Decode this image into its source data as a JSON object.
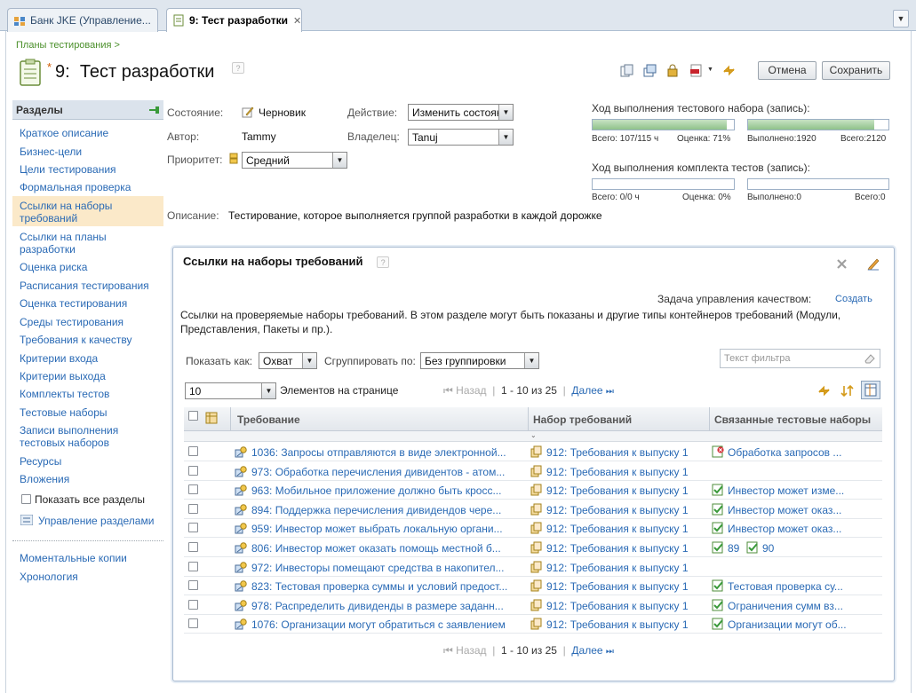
{
  "tabs": [
    {
      "label": "Банк JKE (Управление...",
      "active": false
    },
    {
      "label": "9: Тест разработки",
      "active": true
    }
  ],
  "breadcrumb": "Планы тестирования >",
  "title": {
    "number": "9:",
    "name": "Тест разработки",
    "modified_mark": "*"
  },
  "buttons": {
    "cancel": "Отмена",
    "save": "Сохранить"
  },
  "sidebar": {
    "header": "Разделы",
    "items": [
      "Краткое описание",
      "Бизнес-цели",
      "Цели тестирования",
      "Формальная проверка",
      "Ссылки на наборы требований",
      "Ссылки на планы разработки",
      "Оценка риска",
      "Расписания тестирования",
      "Оценка тестирования",
      "Среды тестирования",
      "Требования к качеству",
      "Критерии входа",
      "Критерии выхода",
      "Комплекты тестов",
      "Тестовые наборы",
      "Записи выполнения тестовых наборов",
      "Ресурсы",
      "Вложения"
    ],
    "selected_index": 4,
    "show_all_label": "Показать все разделы",
    "manage_label": "Управление разделами",
    "bottom_items": [
      "Моментальные копии",
      "Хронология"
    ]
  },
  "form": {
    "state_label": "Состояние:",
    "state_value": "Черновик",
    "author_label": "Автор:",
    "author_value": "Tammy",
    "priority_label": "Приоритет:",
    "priority_value": "Средний",
    "action_label": "Действие:",
    "action_value": "Изменить состояние",
    "owner_label": "Владелец:",
    "owner_value": "Tanuj",
    "description_label": "Описание:",
    "description_value": "Тестирование, которое выполняется группой разработки в каждой дорожке"
  },
  "progress": {
    "suite_title": "Ход выполнения тестового набора (запись):",
    "suite_left": {
      "fill": 0.95,
      "total": "Всего: 107/115 ч",
      "estimate": "Оценка: 71%"
    },
    "suite_right": {
      "fill": 0.9,
      "done": "Выполнено:1920",
      "total": "Всего:2120"
    },
    "kit_title": "Ход выполнения комплекта тестов (запись):",
    "kit_left": {
      "fill": 0,
      "total": "Всего: 0/0 ч",
      "estimate": "Оценка: 0%"
    },
    "kit_right": {
      "fill": 0,
      "done": "Выполнено:0",
      "total": "Всего:0"
    }
  },
  "panel": {
    "title": "Ссылки на наборы требований",
    "quality_task_label": "Задача управления качеством:",
    "create_link": "Создать",
    "description": "Ссылки на проверяемые наборы требований. В этом разделе могут быть показаны и другие типы контейнеров требований (Модули, Представления, Пакеты и пр.).",
    "show_as_label": "Показать как:",
    "show_as_value": "Охват",
    "group_by_label": "Сгруппировать по:",
    "group_by_value": "Без группировки",
    "filter_placeholder": "Текст фильтра",
    "page_size": "10",
    "page_size_label": "Элементов на странице",
    "pager": {
      "prev": "Назад",
      "range": "1 - 10 из 25",
      "next": "Далее"
    },
    "columns": [
      "Требование",
      "Набор требований",
      "Связанные тестовые наборы"
    ],
    "rows": [
      {
        "req": "1036: Запросы отправляются в виде электронной...",
        "set": "912: Требования к выпуску 1",
        "suites": [
          "Обработка запросов ..."
        ],
        "suite_status": "error"
      },
      {
        "req": "973: Обработка перечисления дивидентов - атом...",
        "set": "912: Требования к выпуску 1",
        "suites": [],
        "suite_status": ""
      },
      {
        "req": "963: Мобильное приложение должно быть кросс...",
        "set": "912: Требования к выпуску 1",
        "suites": [
          "Инвестор может изме..."
        ],
        "suite_status": "ok"
      },
      {
        "req": "894: Поддержка перечисления дивидендов чере...",
        "set": "912: Требования к выпуску 1",
        "suites": [
          "Инвестор может оказ..."
        ],
        "suite_status": "ok"
      },
      {
        "req": "959: Инвестор может выбрать локальную органи...",
        "set": "912: Требования к выпуску 1",
        "suites": [
          "Инвестор может оказ..."
        ],
        "suite_status": "ok"
      },
      {
        "req": "806: Инвестор может оказать помощь местной б...",
        "set": "912: Требования к выпуску 1",
        "suites": [
          "89",
          "90"
        ],
        "suite_status": "ok"
      },
      {
        "req": "972: Инвесторы помещают средства в накопител...",
        "set": "912: Требования к выпуску 1",
        "suites": [],
        "suite_status": ""
      },
      {
        "req": "823: Тестовая проверка суммы и условий предост...",
        "set": "912: Требования к выпуску 1",
        "suites": [
          "Тестовая проверка су..."
        ],
        "suite_status": "ok"
      },
      {
        "req": "978: Распределить дивиденды в размере заданн...",
        "set": "912: Требования к выпуску 1",
        "suites": [
          "Ограничения сумм вз..."
        ],
        "suite_status": "ok"
      },
      {
        "req": "1076: Организации могут обратиться с заявлением",
        "set": "912: Требования к выпуску 1",
        "suites": [
          "Организации могут об..."
        ],
        "suite_status": "ok"
      }
    ]
  },
  "colors": {
    "accent": "#2a6ab5",
    "selected_nav": "#fbe9c9",
    "progress_fill": "#8fc28a"
  }
}
